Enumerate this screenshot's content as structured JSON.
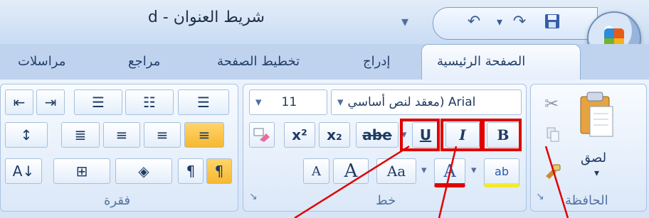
{
  "window": {
    "title": "شريط العنوان - d"
  },
  "tabs": {
    "home": "الصفحة الرئيسية",
    "insert": "إدراج",
    "page_layout": "تخطيط الصفحة",
    "references": "مراجع",
    "mailings": "مراسلات"
  },
  "groups": {
    "clipboard": {
      "label": "الحافظة",
      "paste_label": "لصق"
    },
    "font": {
      "label": "خط",
      "font_name": "معقد لنص أساسي) Arial",
      "font_size": "11",
      "bold": "B",
      "italic": "I",
      "underline": "U",
      "strikethrough": "abe",
      "subscript": "x₂",
      "superscript": "x²",
      "change_case": "Aa",
      "grow_font": "A",
      "shrink_font": "A",
      "font_color": "A",
      "highlight_text": "ab"
    },
    "paragraph": {
      "label": "فقرة"
    }
  },
  "colors": {
    "highlight_red": "#e00000",
    "ribbon_blue": "#d5e4f7",
    "accent_text": "#23406a"
  }
}
